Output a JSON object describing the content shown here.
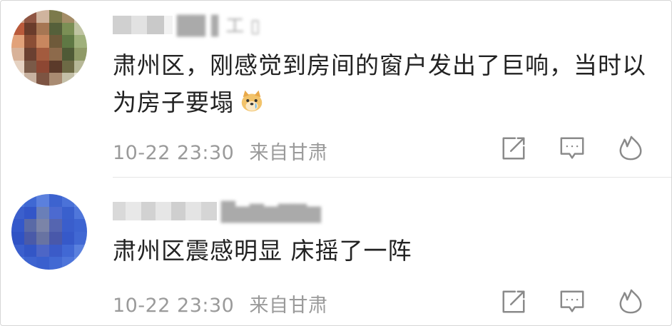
{
  "comments": [
    {
      "username": "██ ▌工 ▯",
      "text": "肃州区，刚感觉到房间的窗户发出了巨响，当时以为房子要塌",
      "emoji": "crying-doge-emoji",
      "time": "10-22 23:30",
      "location": "来自甘肃",
      "actions": [
        "share-icon",
        "comment-icon",
        "like-icon"
      ]
    },
    {
      "username": "█▆▇▆▇▇▆",
      "text": "肃州区震感明显 床摇了一阵",
      "time": "10-22 23:30",
      "location": "来自甘肃",
      "actions": [
        "share-icon",
        "comment-icon",
        "like-icon"
      ]
    }
  ],
  "colors": {
    "text": "#222222",
    "meta": "#9a9a9a",
    "icon": "#8a8a8a",
    "divider": "#e6e6e6"
  }
}
